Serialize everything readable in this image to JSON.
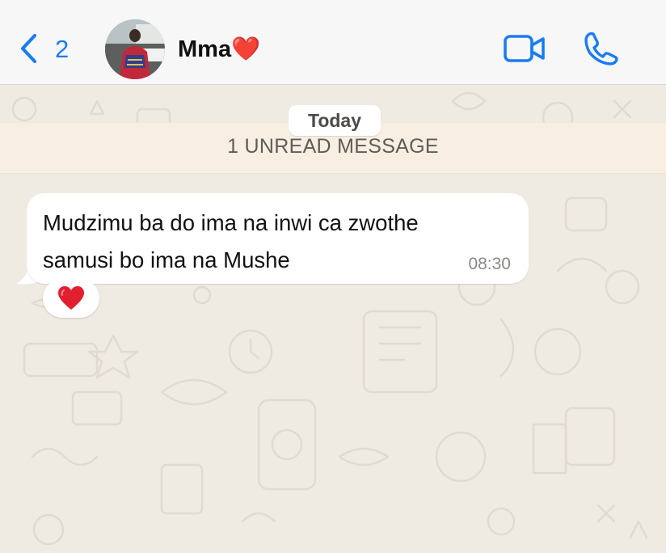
{
  "header": {
    "back_count": "2",
    "contact_name": "Mma",
    "contact_emoji": "❤️",
    "icons": {
      "back": "chevron-left-icon",
      "video": "video-camera-icon",
      "call": "phone-icon"
    },
    "accent_color": "#1a7cf2"
  },
  "chat": {
    "date_label": "Today",
    "unread_label": "1 UNREAD MESSAGE",
    "messages": [
      {
        "text_line1": "Mudzimu ba do ima na inwi ca zwothe",
        "text_line2": "samusi bo ima na Mushe",
        "time": "08:30",
        "reaction": "❤️"
      }
    ],
    "background_color": "#efeae2",
    "bubble_color": "#ffffff"
  }
}
